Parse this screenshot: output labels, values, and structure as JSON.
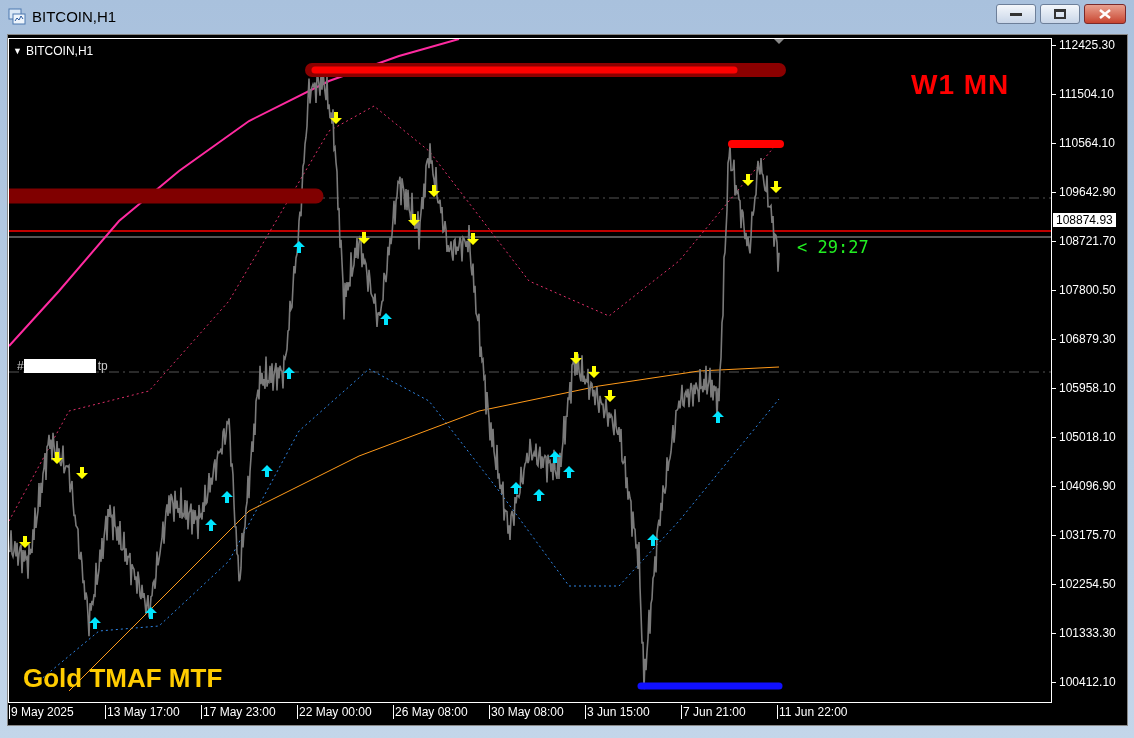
{
  "window": {
    "title": "BITCOIN,H1",
    "buttons": [
      {
        "kind": "minimize"
      },
      {
        "kind": "maximize"
      },
      {
        "kind": "close"
      }
    ]
  },
  "chart": {
    "symbol_menu": "▼",
    "symbol": "BITCOIN,H1",
    "price_axis": [
      "112425.30",
      "111504.10",
      "110564.10",
      "109642.90",
      "108721.70",
      "107800.50",
      "106879.30",
      "105958.10",
      "105018.10",
      "104096.90",
      "103175.70",
      "102254.50",
      "101333.30",
      "100412.10"
    ],
    "current_price": "108874.93",
    "time_axis": [
      "9 May 2025",
      "13 May 17:00",
      "17 May 23:00",
      "22 May 00:00",
      "26 May 08:00",
      "30 May 08:00",
      "3 Jun 15:00",
      "7 Jun 21:00",
      "11 Jun 22:00"
    ],
    "timeframe_label": "W1 MN",
    "indicator_label": "Gold TMAF MTF",
    "countdown": "< 29:27",
    "order_label": {
      "prefix": "#",
      "suffix": "tp"
    }
  }
}
